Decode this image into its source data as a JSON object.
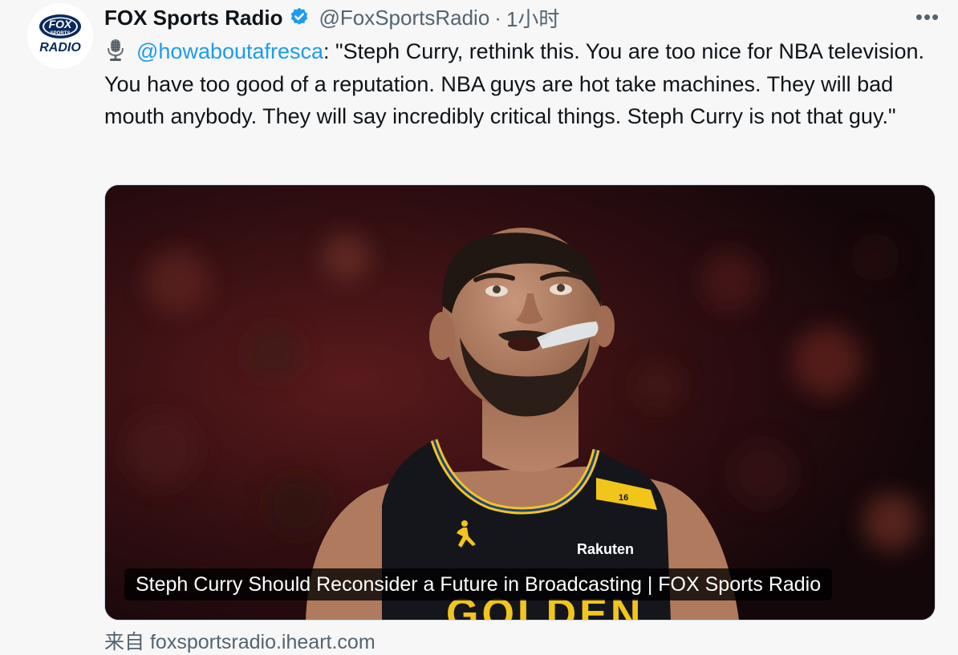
{
  "tweet": {
    "author": {
      "display_name": "FOX Sports Radio",
      "handle": "@FoxSportsRadio",
      "separator": "·",
      "time": "1小时",
      "avatar": {
        "line1": "FOX",
        "line2": "SPORTS",
        "line3": "RADIO",
        "colors": {
          "navy": "#0a2a5c",
          "white": "#ffffff"
        }
      },
      "verified_icon": "verified-badge-icon"
    },
    "more_label": "•••",
    "text": {
      "emoji_icon": "studio-microphone-icon",
      "mention": "@howaboutafresca",
      "body": ": \"Steph Curry, rethink this. You are too nice for NBA television. You have too good of a reputation. NBA guys are hot take machines. They will bad mouth anybody. They will say incredibly critical things. Steph Curry is not that guy.\""
    },
    "card": {
      "caption": "Steph Curry Should Reconsider a Future in Broadcasting | FOX Sports Radio",
      "jersey": {
        "number": "16",
        "sponsor": "Rakuten",
        "team_text": "GOLDEN"
      }
    },
    "source": {
      "prefix": "来自",
      "domain": "foxsportsradio.iheart.com"
    }
  },
  "colors": {
    "text": "#0f1419",
    "secondary": "#536471",
    "link": "#1d9bf0",
    "verified": "#1d9bf0",
    "background": "#f7f7f7"
  }
}
